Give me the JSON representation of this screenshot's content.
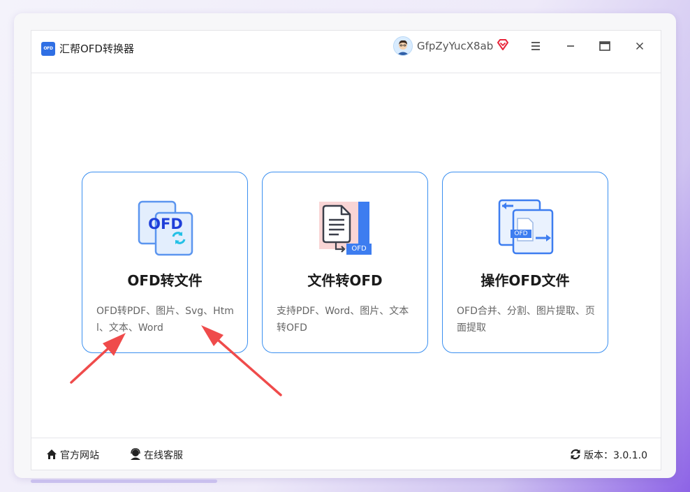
{
  "window": {
    "title": "汇帮OFD转换器",
    "logo_text": "OFD"
  },
  "user": {
    "name": "GfpZyYucX8ab",
    "vip_color": "#e8253a"
  },
  "cards": [
    {
      "title": "OFD转文件",
      "description": "OFD转PDF、图片、Svg、Html、文本、Word",
      "icon": "ofd-convert-icon"
    },
    {
      "title": "文件转OFD",
      "description": "支持PDF、Word、图片、文本转OFD",
      "icon": "file-to-ofd-icon",
      "badge": "OFD"
    },
    {
      "title": "操作OFD文件",
      "description": "OFD合并、分割、图片提取、页面提取",
      "icon": "ofd-operate-icon",
      "badge": "OFD"
    }
  ],
  "footer": {
    "website": "官方网站",
    "support": "在线客服",
    "version": "版本：3.0.1.0"
  },
  "colors": {
    "accent": "#3a8ff0",
    "annotation_arrow": "#ef4b4b"
  }
}
